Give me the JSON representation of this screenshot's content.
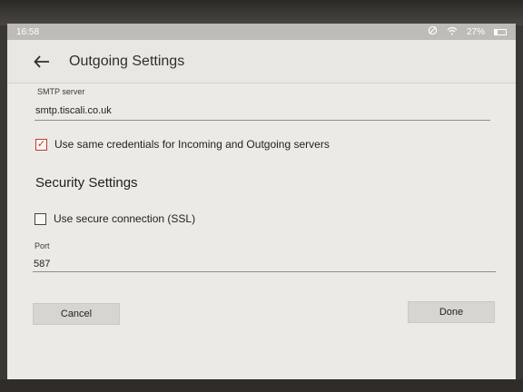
{
  "status": {
    "time": "16:58",
    "battery": "27%",
    "icons": [
      "rotation-lock-icon",
      "wifi-icon",
      "battery-icon"
    ]
  },
  "appbar": {
    "title": "Outgoing Settings",
    "back_icon": "arrow-left-icon"
  },
  "smtp": {
    "label": "SMTP server",
    "value": "smtp.tiscali.co.uk"
  },
  "same_credentials": {
    "label": "Use same credentials for Incoming and Outgoing servers",
    "checked": true
  },
  "security": {
    "title": "Security Settings",
    "ssl_label": "Use secure connection (SSL)",
    "ssl_checked": false
  },
  "port": {
    "label": "Port",
    "value": "587"
  },
  "buttons": {
    "cancel": "Cancel",
    "done": "Done"
  },
  "colors": {
    "accent": "#c23b2b",
    "background": "#eceae6",
    "button": "#d7d5d1"
  }
}
